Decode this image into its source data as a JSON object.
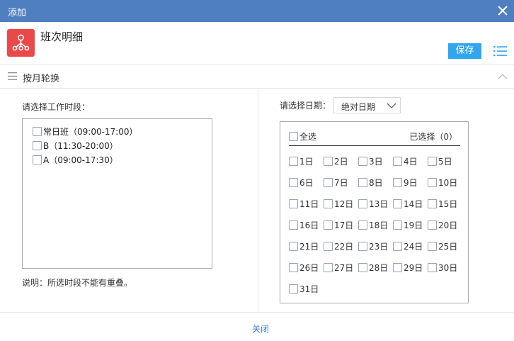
{
  "dialog": {
    "title": "添加"
  },
  "header": {
    "title": "班次明细",
    "save_label": "保存"
  },
  "section": {
    "label": "按月轮换"
  },
  "left": {
    "label": "请选择工作时段：",
    "periods": [
      {
        "label": "常日班（09:00-17:00）"
      },
      {
        "label": "B（11:30-20:00）"
      },
      {
        "label": "A（09:00-17:30）"
      }
    ],
    "note": "说明：所选时段不能有重叠。"
  },
  "right": {
    "label": "请选择日期：",
    "date_type": "绝对日期",
    "select_all_label": "全选",
    "selected_text": "已选择（0）",
    "days": [
      "1日",
      "2日",
      "3日",
      "4日",
      "5日",
      "6日",
      "7日",
      "8日",
      "9日",
      "10日",
      "11日",
      "12日",
      "13日",
      "14日",
      "15日",
      "16日",
      "17日",
      "18日",
      "19日",
      "20日",
      "21日",
      "22日",
      "23日",
      "24日",
      "25日",
      "26日",
      "27日",
      "28日",
      "29日",
      "30日",
      "31日"
    ]
  },
  "footer": {
    "close_label": "关闭"
  },
  "colors": {
    "titlebar": "#4f7fc0",
    "accent": "#2fa6ef",
    "app_icon": "#e94949",
    "link": "#3d7ccf"
  },
  "icons": {
    "close": "close-icon",
    "app": "share-nodes-icon",
    "list": "list-icon",
    "menu": "menu-icon",
    "collapse": "chevron-up-icon",
    "dropdown": "chevron-down-icon"
  }
}
